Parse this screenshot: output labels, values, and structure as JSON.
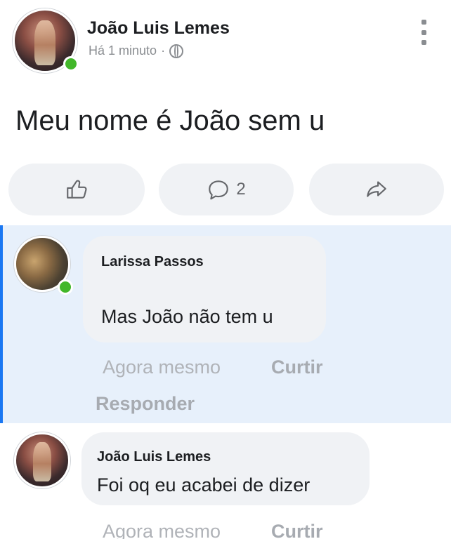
{
  "post": {
    "author": "João Luis Lemes",
    "time": "Há 1 minuto",
    "separator": "·",
    "text": "Meu nome é João sem u",
    "comment_count": "2"
  },
  "comments": [
    {
      "author": "Larissa Passos",
      "text": "Mas João não tem u",
      "time": "Agora mesmo",
      "like": "Curtir",
      "reply": "Responder"
    },
    {
      "author": "João Luis Lemes",
      "text": "Foi oq eu acabei de dizer",
      "time": "Agora mesmo",
      "like": "Curtir"
    }
  ],
  "icons": {
    "privacy": "globe-icon",
    "menu": "kebab-icon",
    "like": "thumbs-up-icon",
    "comment": "comment-bubble-icon",
    "share": "share-arrow-icon"
  },
  "colors": {
    "online": "#42b72a",
    "highlight": "#e7f0fb",
    "accent": "#1a77f2",
    "bubble": "#f0f2f5"
  }
}
